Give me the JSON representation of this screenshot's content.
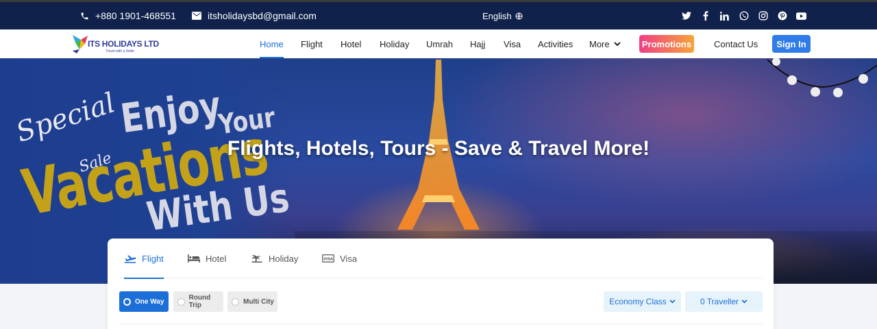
{
  "topbar": {
    "phone": "+880 1901-468551",
    "email": "itsholidaysbd@gmail.com",
    "language": "English",
    "socials": [
      "twitter-icon",
      "facebook-icon",
      "linkedin-icon",
      "whatsapp-icon",
      "instagram-icon",
      "pinterest-icon",
      "youtube-icon"
    ]
  },
  "nav": {
    "logo_title": "ITS HOLIDAYS LTD",
    "logo_tagline": "Travel with a Smile",
    "items": [
      "Home",
      "Flight",
      "Hotel",
      "Holiday",
      "Umrah",
      "Hajj",
      "Visa",
      "Activities",
      "More"
    ],
    "active": "Home",
    "promotions": "Promotions",
    "contact": "Contact Us",
    "signin": "Sign In"
  },
  "hero": {
    "title": "Flights, Hotels, Tours - Save & Travel More!",
    "banner": {
      "special": "Special",
      "sale": "Sale",
      "enjoy": "Enjoy",
      "your": "Your",
      "vacations": "Vacations",
      "with_us": "With Us"
    }
  },
  "search": {
    "tabs": [
      "Flight",
      "Hotel",
      "Holiday",
      "Visa"
    ],
    "active_tab": "Flight",
    "trip_types": [
      "One Way",
      "Round Trip",
      "Multi City"
    ],
    "selected_trip": "One Way",
    "cabin_class": "Economy Class",
    "travellers": "0 Traveller"
  },
  "colors": {
    "topbar": "#10214b",
    "accent": "#1d6fd8",
    "signin": "#2f7ce8",
    "promo_gradient": [
      "#ef3f86",
      "#f6a43a"
    ]
  }
}
